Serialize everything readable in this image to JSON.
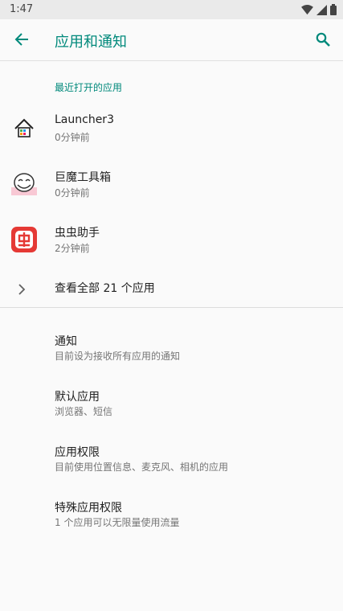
{
  "status_bar": {
    "time": "1:47"
  },
  "app_bar": {
    "title": "应用和通知",
    "back_icon": "arrow-left-icon",
    "search_icon": "search-icon"
  },
  "recent": {
    "header": "最近打开的应用",
    "apps": [
      {
        "name": "Launcher3",
        "time": "0分钟前",
        "icon": "launcher-house-icon"
      },
      {
        "name": "巨魔工具箱",
        "time": "0分钟前",
        "icon": "troll-face-icon"
      },
      {
        "name": "虫虫助手",
        "time": "2分钟前",
        "icon": "chongchong-icon"
      }
    ],
    "see_all": "查看全部 21 个应用"
  },
  "settings": [
    {
      "title": "通知",
      "summary": "目前设为接收所有应用的通知"
    },
    {
      "title": "默认应用",
      "summary": "浏览器、短信"
    },
    {
      "title": "应用权限",
      "summary": "目前使用位置信息、麦克风、相机的应用"
    },
    {
      "title": "特殊应用权限",
      "summary": "1 个应用可以无限量使用流量"
    }
  ],
  "colors": {
    "accent": "#00897b",
    "background": "#fafafa",
    "status_bar": "#eaeaea"
  }
}
